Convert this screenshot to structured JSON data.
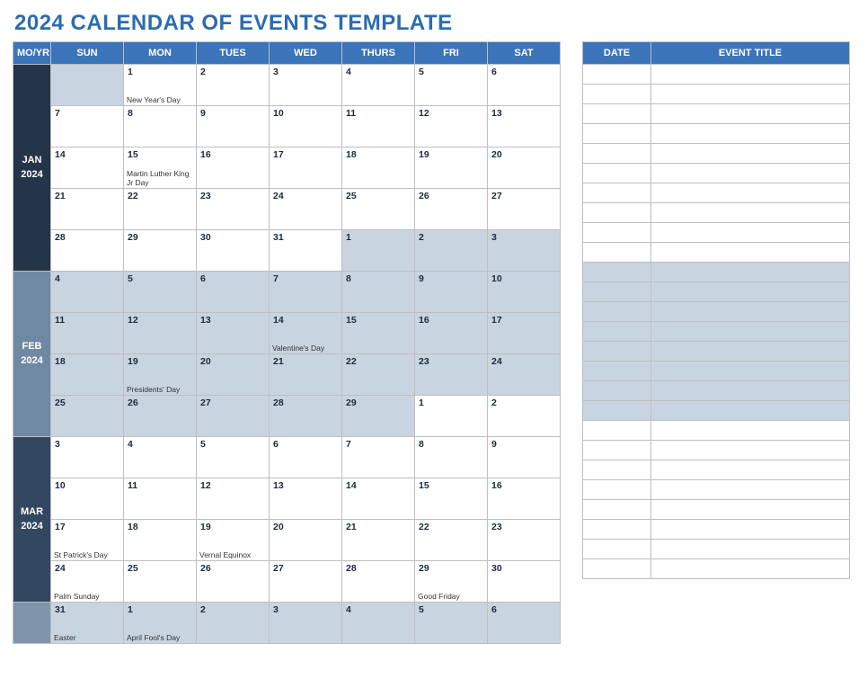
{
  "title": "2024 CALENDAR OF EVENTS TEMPLATE",
  "headers": {
    "moyr": "MO/YR",
    "days": [
      "SUN",
      "MON",
      "TUES",
      "WED",
      "THURS",
      "FRI",
      "SAT"
    ],
    "date": "DATE",
    "event_title": "EVENT TITLE"
  },
  "months": [
    {
      "id": "jan",
      "label": "JAN",
      "year": "2024",
      "labelClass": "ml-jan",
      "weeks": [
        [
          {
            "n": "",
            "e": "",
            "dim": true
          },
          {
            "n": "1",
            "e": "New Year's Day"
          },
          {
            "n": "2",
            "e": ""
          },
          {
            "n": "3",
            "e": ""
          },
          {
            "n": "4",
            "e": ""
          },
          {
            "n": "5",
            "e": ""
          },
          {
            "n": "6",
            "e": ""
          }
        ],
        [
          {
            "n": "7",
            "e": ""
          },
          {
            "n": "8",
            "e": ""
          },
          {
            "n": "9",
            "e": ""
          },
          {
            "n": "10",
            "e": ""
          },
          {
            "n": "11",
            "e": ""
          },
          {
            "n": "12",
            "e": ""
          },
          {
            "n": "13",
            "e": ""
          }
        ],
        [
          {
            "n": "14",
            "e": ""
          },
          {
            "n": "15",
            "e": "Martin Luther King Jr Day"
          },
          {
            "n": "16",
            "e": ""
          },
          {
            "n": "17",
            "e": ""
          },
          {
            "n": "18",
            "e": ""
          },
          {
            "n": "19",
            "e": ""
          },
          {
            "n": "20",
            "e": ""
          }
        ],
        [
          {
            "n": "21",
            "e": ""
          },
          {
            "n": "22",
            "e": ""
          },
          {
            "n": "23",
            "e": ""
          },
          {
            "n": "24",
            "e": ""
          },
          {
            "n": "25",
            "e": ""
          },
          {
            "n": "26",
            "e": ""
          },
          {
            "n": "27",
            "e": ""
          }
        ],
        [
          {
            "n": "28",
            "e": ""
          },
          {
            "n": "29",
            "e": ""
          },
          {
            "n": "30",
            "e": ""
          },
          {
            "n": "31",
            "e": ""
          },
          {
            "n": "1",
            "e": "",
            "dim": true
          },
          {
            "n": "2",
            "e": "",
            "dim": true
          },
          {
            "n": "3",
            "e": "",
            "dim": true
          }
        ]
      ]
    },
    {
      "id": "feb",
      "label": "FEB",
      "year": "2024",
      "labelClass": "ml-feb",
      "weeks": [
        [
          {
            "n": "4",
            "e": "",
            "dim": true
          },
          {
            "n": "5",
            "e": "",
            "dim": true
          },
          {
            "n": "6",
            "e": "",
            "dim": true
          },
          {
            "n": "7",
            "e": "",
            "dim": true
          },
          {
            "n": "8",
            "e": "",
            "dim": true
          },
          {
            "n": "9",
            "e": "",
            "dim": true
          },
          {
            "n": "10",
            "e": "",
            "dim": true
          }
        ],
        [
          {
            "n": "11",
            "e": "",
            "dim": true
          },
          {
            "n": "12",
            "e": "",
            "dim": true
          },
          {
            "n": "13",
            "e": "",
            "dim": true
          },
          {
            "n": "14",
            "e": "Valentine's Day",
            "dim": true
          },
          {
            "n": "15",
            "e": "",
            "dim": true
          },
          {
            "n": "16",
            "e": "",
            "dim": true
          },
          {
            "n": "17",
            "e": "",
            "dim": true
          }
        ],
        [
          {
            "n": "18",
            "e": "",
            "dim": true
          },
          {
            "n": "19",
            "e": "Presidents' Day",
            "dim": true
          },
          {
            "n": "20",
            "e": "",
            "dim": true
          },
          {
            "n": "21",
            "e": "",
            "dim": true
          },
          {
            "n": "22",
            "e": "",
            "dim": true
          },
          {
            "n": "23",
            "e": "",
            "dim": true
          },
          {
            "n": "24",
            "e": "",
            "dim": true
          }
        ],
        [
          {
            "n": "25",
            "e": "",
            "dim": true
          },
          {
            "n": "26",
            "e": "",
            "dim": true
          },
          {
            "n": "27",
            "e": "",
            "dim": true
          },
          {
            "n": "28",
            "e": "",
            "dim": true
          },
          {
            "n": "29",
            "e": "",
            "dim": true
          },
          {
            "n": "1",
            "e": ""
          },
          {
            "n": "2",
            "e": ""
          }
        ]
      ]
    },
    {
      "id": "mar",
      "label": "MAR",
      "year": "2024",
      "labelClass": "ml-mar",
      "weeks": [
        [
          {
            "n": "3",
            "e": ""
          },
          {
            "n": "4",
            "e": ""
          },
          {
            "n": "5",
            "e": ""
          },
          {
            "n": "6",
            "e": ""
          },
          {
            "n": "7",
            "e": ""
          },
          {
            "n": "8",
            "e": ""
          },
          {
            "n": "9",
            "e": ""
          }
        ],
        [
          {
            "n": "10",
            "e": ""
          },
          {
            "n": "11",
            "e": ""
          },
          {
            "n": "12",
            "e": ""
          },
          {
            "n": "13",
            "e": ""
          },
          {
            "n": "14",
            "e": ""
          },
          {
            "n": "15",
            "e": ""
          },
          {
            "n": "16",
            "e": ""
          }
        ],
        [
          {
            "n": "17",
            "e": "St Patrick's Day"
          },
          {
            "n": "18",
            "e": ""
          },
          {
            "n": "19",
            "e": "Vernal Equinox"
          },
          {
            "n": "20",
            "e": ""
          },
          {
            "n": "21",
            "e": ""
          },
          {
            "n": "22",
            "e": ""
          },
          {
            "n": "23",
            "e": ""
          }
        ],
        [
          {
            "n": "24",
            "e": "Palm Sunday"
          },
          {
            "n": "25",
            "e": ""
          },
          {
            "n": "26",
            "e": ""
          },
          {
            "n": "27",
            "e": ""
          },
          {
            "n": "28",
            "e": ""
          },
          {
            "n": "29",
            "e": "Good Friday"
          },
          {
            "n": "30",
            "e": ""
          }
        ]
      ]
    },
    {
      "id": "apr",
      "label": "",
      "year": "",
      "labelClass": "ml-apr",
      "weeks": [
        [
          {
            "n": "31",
            "e": "Easter",
            "dim": true
          },
          {
            "n": "1",
            "e": "April Fool's Day",
            "dim": true
          },
          {
            "n": "2",
            "e": "",
            "dim": true
          },
          {
            "n": "3",
            "e": "",
            "dim": true
          },
          {
            "n": "4",
            "e": "",
            "dim": true
          },
          {
            "n": "5",
            "e": "",
            "dim": true
          },
          {
            "n": "6",
            "e": "",
            "dim": true
          }
        ]
      ]
    }
  ],
  "event_rows_per_month": {
    "jan": 10,
    "feb": 8,
    "mar": 8
  }
}
